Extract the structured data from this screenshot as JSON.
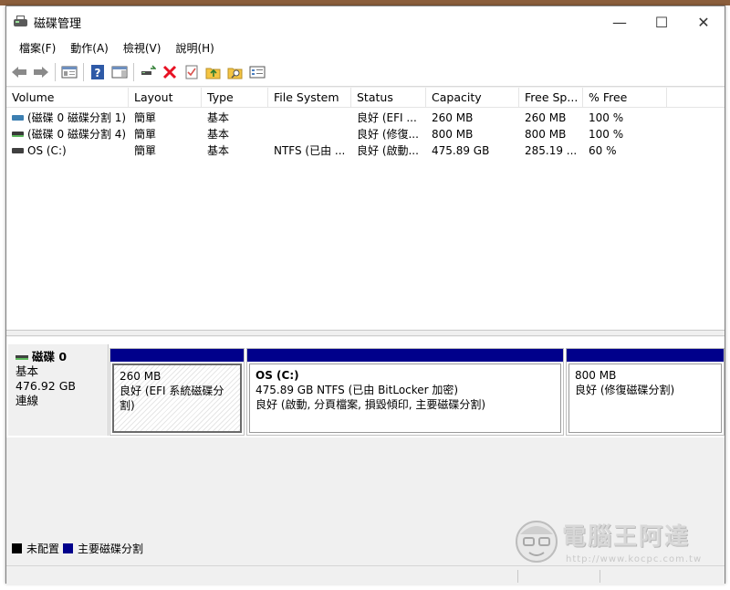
{
  "window": {
    "title": "磁碟管理",
    "minimize_glyph": "—",
    "maximize_glyph": "☐",
    "close_glyph": "✕"
  },
  "menu": [
    "檔案(F)",
    "動作(A)",
    "檢視(V)",
    "說明(H)"
  ],
  "toolbar": {
    "icons": [
      "back-arrow-icon",
      "forward-arrow-icon",
      "console-tree-icon",
      "help-icon",
      "properties-panel-icon",
      "connect-drive-icon",
      "delete-icon",
      "checklist-icon",
      "folder-up-icon",
      "folder-search-icon",
      "details-icon"
    ],
    "delete_color": "#e81123",
    "help_color": "#2e5aa7"
  },
  "table": {
    "columns": [
      "Volume",
      "Layout",
      "Type",
      "File System",
      "Status",
      "Capacity",
      "Free Sp...",
      "% Free"
    ],
    "rows": [
      [
        "(磁碟 0 磁碟分割 1)",
        "簡單",
        "基本",
        "",
        "良好 (EFI ...",
        "260 MB",
        "260 MB",
        "100 %"
      ],
      [
        "(磁碟 0 磁碟分割 4)",
        "簡單",
        "基本",
        "",
        "良好 (修復...",
        "800 MB",
        "800 MB",
        "100 %"
      ],
      [
        "OS (C:)",
        "簡單",
        "基本",
        "NTFS (已由 ...",
        "良好 (啟動...",
        "475.89 GB",
        "285.19 ...",
        "60 %"
      ]
    ]
  },
  "disk": {
    "name": "磁碟 0",
    "type": "基本",
    "size": "476.92 GB",
    "state": "連線",
    "partitions": [
      {
        "title": "",
        "size": "260 MB",
        "status": "良好 (EFI 系統磁碟分割)"
      },
      {
        "title": "OS  (C:)",
        "size": "475.89 GB NTFS (已由 BitLocker 加密)",
        "status": "良好 (啟動, 分頁檔案, 損毀傾印, 主要磁碟分割)"
      },
      {
        "title": "",
        "size": "800 MB",
        "status": "良好 (修復磁碟分割)"
      }
    ]
  },
  "legend": {
    "unallocated": "未配置",
    "primary": "主要磁碟分割",
    "unallocated_color": "#000000",
    "primary_color": "#00008b"
  },
  "watermark": {
    "text": "電腦王阿達",
    "url": "http://www.kocpc.com.tw"
  }
}
